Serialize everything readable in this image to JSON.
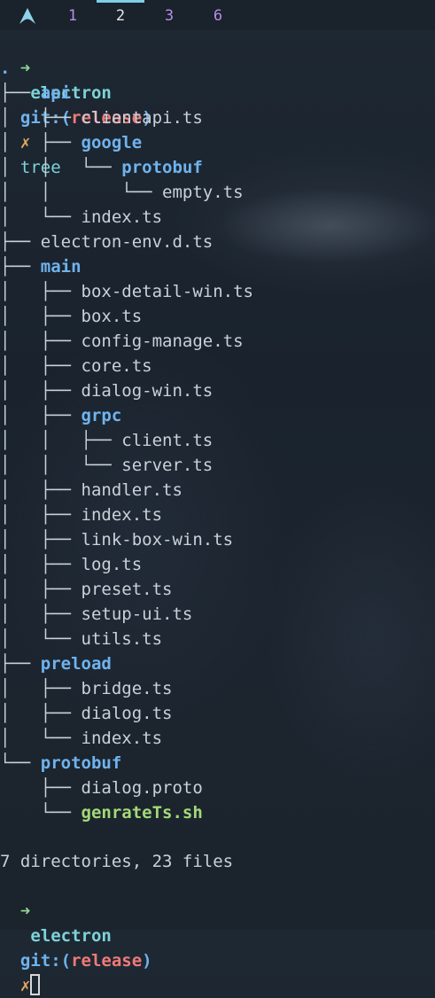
{
  "workspaces": [
    {
      "label": "1",
      "active": false
    },
    {
      "label": "2",
      "active": true
    },
    {
      "label": "3",
      "active": false
    },
    {
      "label": "6",
      "active": false
    }
  ],
  "prompt1": {
    "arrow": "➜",
    "dir": "electron",
    "git": "git:(",
    "branch": "release",
    "git_close": ")",
    "dirty": "✗",
    "command": "tree"
  },
  "tree": [
    {
      "prefix": "",
      "name": ".",
      "kind": "dir"
    },
    {
      "prefix": "├── ",
      "name": "api",
      "kind": "dir"
    },
    {
      "prefix": "│   ├── ",
      "name": "clientapi.ts",
      "kind": "file"
    },
    {
      "prefix": "│   ├── ",
      "name": "google",
      "kind": "dir"
    },
    {
      "prefix": "│   │   └── ",
      "name": "protobuf",
      "kind": "dir"
    },
    {
      "prefix": "│   │       └── ",
      "name": "empty.ts",
      "kind": "file"
    },
    {
      "prefix": "│   └── ",
      "name": "index.ts",
      "kind": "file"
    },
    {
      "prefix": "├── ",
      "name": "electron-env.d.ts",
      "kind": "file"
    },
    {
      "prefix": "├── ",
      "name": "main",
      "kind": "dir"
    },
    {
      "prefix": "│   ├── ",
      "name": "box-detail-win.ts",
      "kind": "file"
    },
    {
      "prefix": "│   ├── ",
      "name": "box.ts",
      "kind": "file"
    },
    {
      "prefix": "│   ├── ",
      "name": "config-manage.ts",
      "kind": "file"
    },
    {
      "prefix": "│   ├── ",
      "name": "core.ts",
      "kind": "file"
    },
    {
      "prefix": "│   ├── ",
      "name": "dialog-win.ts",
      "kind": "file"
    },
    {
      "prefix": "│   ├── ",
      "name": "grpc",
      "kind": "dir"
    },
    {
      "prefix": "│   │   ├── ",
      "name": "client.ts",
      "kind": "file"
    },
    {
      "prefix": "│   │   └── ",
      "name": "server.ts",
      "kind": "file"
    },
    {
      "prefix": "│   ├── ",
      "name": "handler.ts",
      "kind": "file"
    },
    {
      "prefix": "│   ├── ",
      "name": "index.ts",
      "kind": "file"
    },
    {
      "prefix": "│   ├── ",
      "name": "link-box-win.ts",
      "kind": "file"
    },
    {
      "prefix": "│   ├── ",
      "name": "log.ts",
      "kind": "file"
    },
    {
      "prefix": "│   ├── ",
      "name": "preset.ts",
      "kind": "file"
    },
    {
      "prefix": "│   ├── ",
      "name": "setup-ui.ts",
      "kind": "file"
    },
    {
      "prefix": "│   └── ",
      "name": "utils.ts",
      "kind": "file"
    },
    {
      "prefix": "├── ",
      "name": "preload",
      "kind": "dir"
    },
    {
      "prefix": "│   ├── ",
      "name": "bridge.ts",
      "kind": "file"
    },
    {
      "prefix": "│   ├── ",
      "name": "dialog.ts",
      "kind": "file"
    },
    {
      "prefix": "│   └── ",
      "name": "index.ts",
      "kind": "file"
    },
    {
      "prefix": "└── ",
      "name": "protobuf",
      "kind": "dir"
    },
    {
      "prefix": "    ├── ",
      "name": "dialog.proto",
      "kind": "file"
    },
    {
      "prefix": "    └── ",
      "name": "genrateTs.sh",
      "kind": "exec"
    }
  ],
  "summary": "7 directories, 23 files",
  "prompt2": {
    "arrow": "➜",
    "dir": "electron",
    "git": "git:(",
    "branch": "release",
    "git_close": ")",
    "dirty": "✗"
  }
}
